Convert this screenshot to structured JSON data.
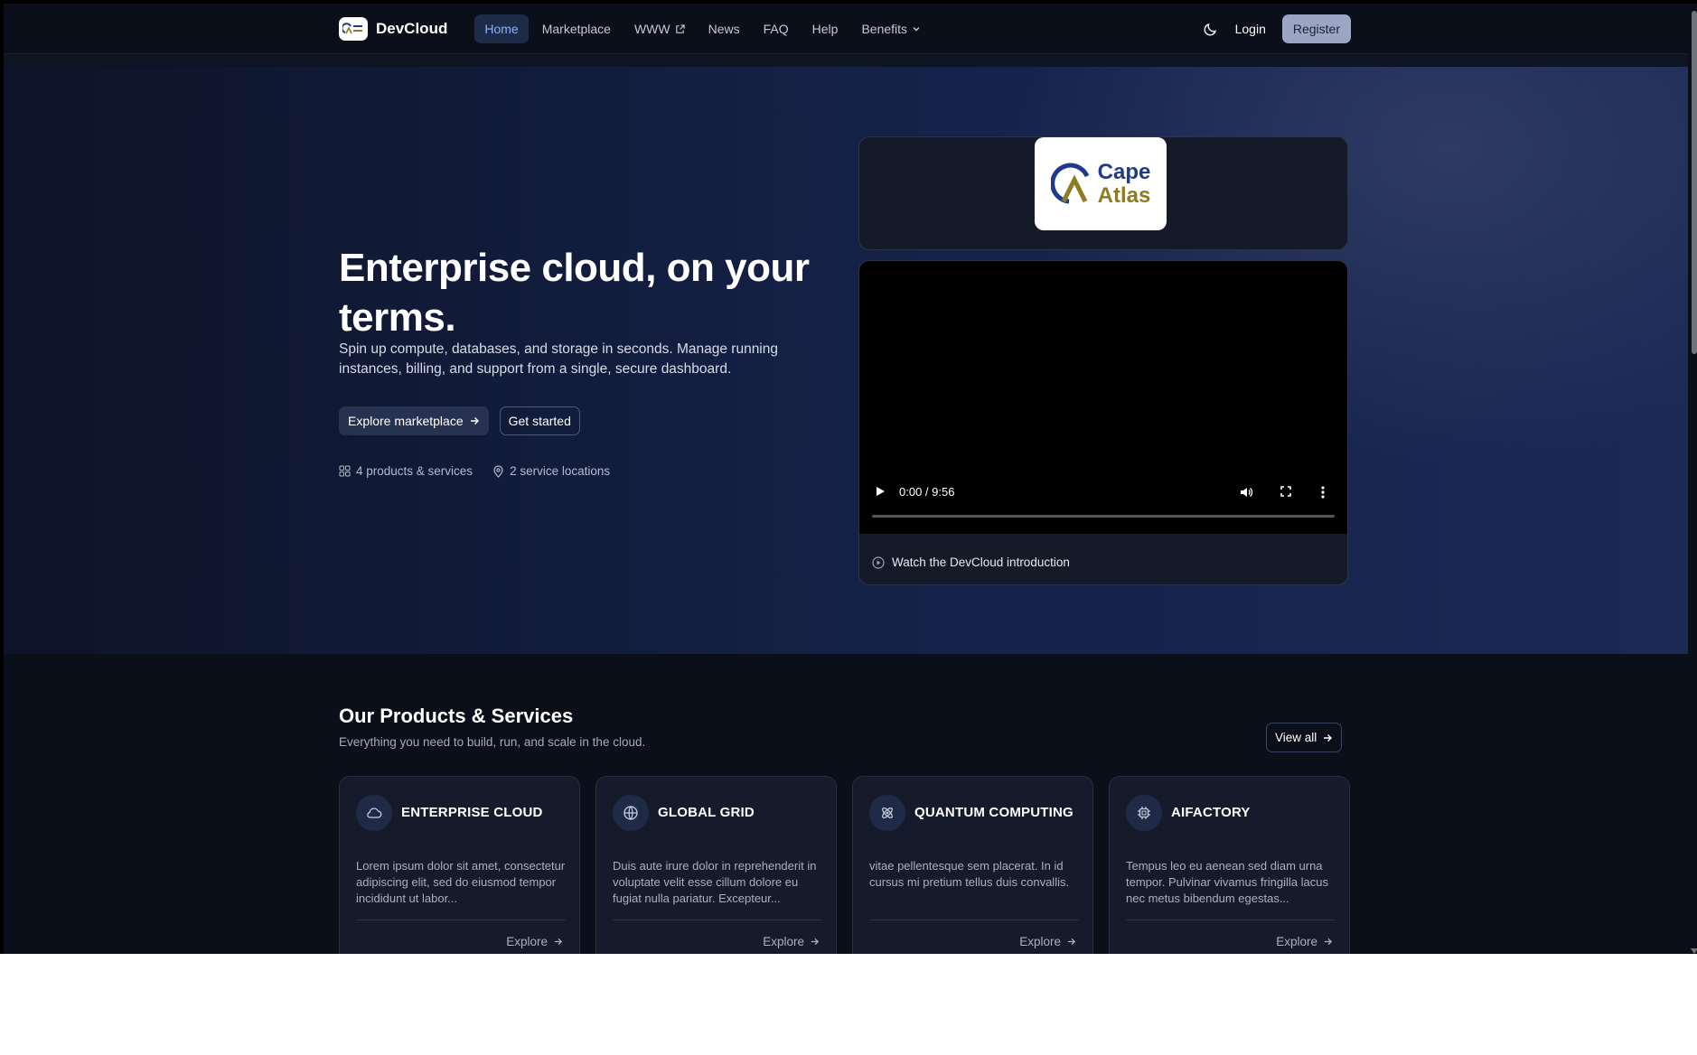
{
  "nav": {
    "brand": "DevCloud",
    "links": [
      {
        "label": "Home"
      },
      {
        "label": "Marketplace"
      },
      {
        "label": "WWW"
      },
      {
        "label": "News"
      },
      {
        "label": "FAQ"
      },
      {
        "label": "Help"
      },
      {
        "label": "Benefits"
      }
    ],
    "login": "Login",
    "register": "Register"
  },
  "hero": {
    "title": "Enterprise cloud, on your terms.",
    "subtitle": "Spin up compute, databases, and storage in seconds. Manage running instances, billing, and support from a single, secure dashboard.",
    "primary_button": "Explore marketplace",
    "secondary_button": "Get started",
    "stats": {
      "products": "4 products & services",
      "locations": "2 service locations"
    }
  },
  "logo": {
    "line1": "Cape",
    "line2": "Atlas"
  },
  "video": {
    "time": "0:00 / 9:56",
    "progress": 0,
    "caption": "Watch the DevCloud introduction"
  },
  "products": {
    "title": "Our Products & Services",
    "subtitle": "Everything you need to build, run, and scale in the cloud.",
    "view_all": "View all",
    "items": [
      {
        "title": "ENTERPRISE CLOUD",
        "icon": "cloud-icon",
        "text": "Lorem ipsum dolor sit amet, consectetur adipiscing elit, sed do eiusmod tempor incididunt ut labor...",
        "link": "Explore"
      },
      {
        "title": "GLOBAL GRID",
        "icon": "globe-icon",
        "text": "Duis aute irure dolor in reprehenderit in voluptate velit esse cillum dolore eu fugiat nulla pariatur. Excepteur...",
        "link": "Explore"
      },
      {
        "title": "QUANTUM COMPUTING",
        "icon": "atom-icon",
        "text": "vitae pellentesque sem placerat. In id cursus mi pretium tellus duis convallis.",
        "link": "Explore"
      },
      {
        "title": "AIFACTORY",
        "icon": "chip-icon",
        "text": "Tempus leo eu aenean sed diam urna tempor. Pulvinar vivamus fringilla lacus nec metus bibendum egestas...",
        "link": "Explore"
      }
    ]
  },
  "colors": {
    "background": "#0b0f19",
    "accent": "#8fb2f5",
    "register_button": "#9ca6c4"
  }
}
